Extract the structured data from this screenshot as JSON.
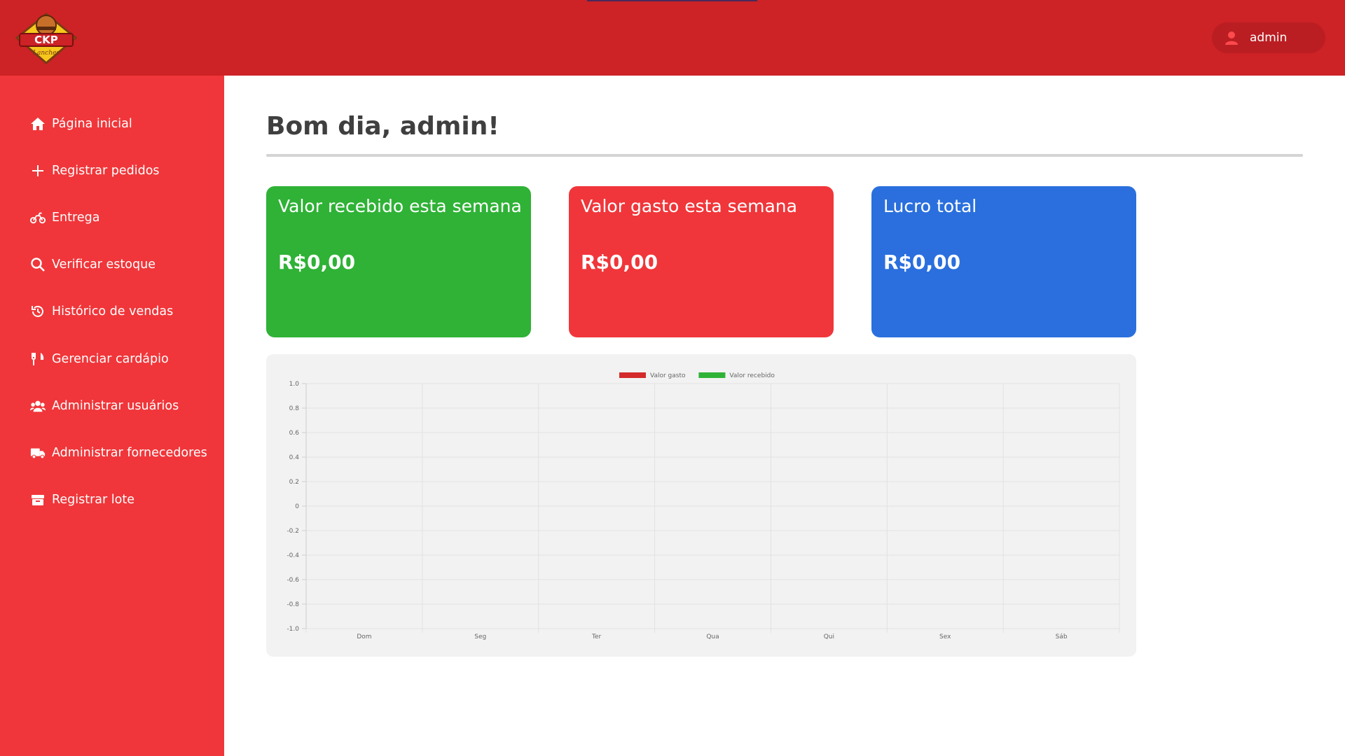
{
  "header": {
    "logo_text": "CKP",
    "logo_subtext": "Lanches",
    "user_name": "admin"
  },
  "sidebar": {
    "items": [
      {
        "label": "Página inicial",
        "icon": "home-icon"
      },
      {
        "label": "Registrar pedidos",
        "icon": "plus-icon"
      },
      {
        "label": "Entrega",
        "icon": "motorcycle-icon"
      },
      {
        "label": "Verificar estoque",
        "icon": "search-icon"
      },
      {
        "label": "Histórico de vendas",
        "icon": "history-icon"
      },
      {
        "label": "Gerenciar cardápio",
        "icon": "utensils-icon"
      },
      {
        "label": "Administrar usuários",
        "icon": "users-icon"
      },
      {
        "label": "Administrar fornecedores",
        "icon": "truck-icon"
      },
      {
        "label": "Registrar lote",
        "icon": "box-icon"
      }
    ]
  },
  "main": {
    "greeting": "Bom dia, admin!",
    "cards": [
      {
        "title": "Valor recebido esta semana",
        "value": "R$0,00"
      },
      {
        "title": "Valor gasto esta semana",
        "value": "R$0,00"
      },
      {
        "title": "Lucro total",
        "value": "R$0,00"
      }
    ]
  },
  "colors": {
    "header": "#cd2226",
    "sidebar": "#f0363a",
    "received": "#2fb236",
    "spent": "#f0363a",
    "profit": "#2a6fdd",
    "series_spent": "#d42a2a",
    "series_received": "#2fb236"
  },
  "chart_data": {
    "type": "line",
    "categories": [
      "Dom",
      "Seg",
      "Ter",
      "Qua",
      "Qui",
      "Sex",
      "Sáb"
    ],
    "y_ticks": [
      "1.0",
      "0.8",
      "0.6",
      "0.4",
      "0.2",
      "0",
      "-0.2",
      "-0.4",
      "-0.6",
      "-0.8",
      "-1.0"
    ],
    "ylim": [
      -1.0,
      1.0
    ],
    "grid": true,
    "legend": "top-center",
    "series": [
      {
        "name": "Valor gasto",
        "values": [],
        "color": "#d42a2a"
      },
      {
        "name": "Valor recebido",
        "values": [],
        "color": "#2fb236"
      }
    ]
  }
}
